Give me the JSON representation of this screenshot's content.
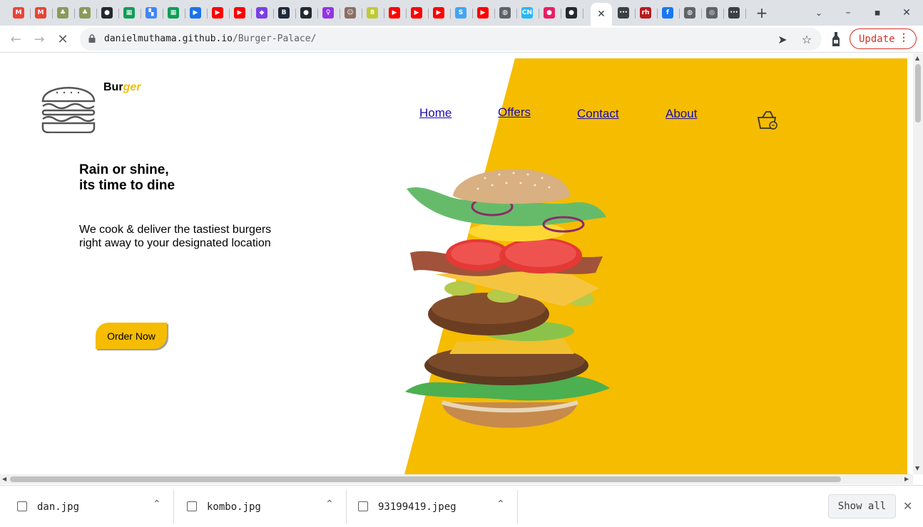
{
  "browser": {
    "tabs": [
      {
        "icon": "gmail-icon",
        "glyph": "M",
        "color": "#ea4335"
      },
      {
        "icon": "gmail-icon",
        "glyph": "M",
        "color": "#ea4335"
      },
      {
        "icon": "tree-icon",
        "glyph": "♣",
        "color": "#8a9a5b"
      },
      {
        "icon": "tree-icon",
        "glyph": "♣",
        "color": "#8a9a5b"
      },
      {
        "icon": "github-icon",
        "glyph": "●",
        "color": "#24292e"
      },
      {
        "icon": "sheets-icon",
        "glyph": "▦",
        "color": "#0f9d58"
      },
      {
        "icon": "colorful-app-icon",
        "glyph": "▚",
        "color": "#4285f4"
      },
      {
        "icon": "sheets-icon",
        "glyph": "▦",
        "color": "#0f9d58"
      },
      {
        "icon": "play-icon",
        "glyph": "▶",
        "color": "#1a73e8"
      },
      {
        "icon": "youtube-icon",
        "glyph": "▶",
        "color": "#ff0000"
      },
      {
        "icon": "youtube-icon",
        "glyph": "▶",
        "color": "#ff0000"
      },
      {
        "icon": "diamond-icon",
        "glyph": "◆",
        "color": "#7b3fe4"
      },
      {
        "icon": "shield-b-icon",
        "glyph": "B",
        "color": "#1e2a3a"
      },
      {
        "icon": "github-icon",
        "glyph": "●",
        "color": "#24292e"
      },
      {
        "icon": "location-pin-icon",
        "glyph": "♀",
        "color": "#9334e6"
      },
      {
        "icon": "person-icon",
        "glyph": "☺",
        "color": "#8d6e63"
      },
      {
        "icon": "badge-8-icon",
        "glyph": "8",
        "color": "#c0ca33"
      },
      {
        "icon": "youtube-icon",
        "glyph": "▶",
        "color": "#ff0000"
      },
      {
        "icon": "youtube-icon",
        "glyph": "▶",
        "color": "#ff0000"
      },
      {
        "icon": "youtube-icon",
        "glyph": "▶",
        "color": "#ff0000"
      },
      {
        "icon": "s-logo-icon",
        "glyph": "S",
        "color": "#42a5f5"
      },
      {
        "icon": "youtube-icon",
        "glyph": "▶",
        "color": "#ff0000"
      },
      {
        "icon": "globe-icon",
        "glyph": "◍",
        "color": "#5f6368"
      },
      {
        "icon": "cn-icon",
        "glyph": "CN",
        "color": "#29b6f6"
      },
      {
        "icon": "red-circle-icon",
        "glyph": "●",
        "color": "#e91e63"
      },
      {
        "icon": "github-icon",
        "glyph": "●",
        "color": "#24292e"
      }
    ],
    "tabs_after_active": [
      {
        "icon": "dots-circle-icon",
        "glyph": "•••",
        "color": "#3c4043"
      },
      {
        "icon": "rh-icon",
        "glyph": "rh",
        "color": "#b71c1c"
      },
      {
        "icon": "facebook-icon",
        "glyph": "f",
        "color": "#1877f2"
      },
      {
        "icon": "globe-icon",
        "glyph": "◍",
        "color": "#5f6368"
      },
      {
        "icon": "chrome-icon",
        "glyph": "◎",
        "color": "#5f6368"
      },
      {
        "icon": "dots-circle-icon",
        "glyph": "•••",
        "color": "#3c4043"
      }
    ],
    "url_host": "danielmuthama.github.io",
    "url_path": "/Burger-Palace/",
    "update_label": "Update"
  },
  "page": {
    "brand_part1": "Bur",
    "brand_part2": "ger",
    "nav": [
      {
        "label": "Home"
      },
      {
        "label": "Offers"
      },
      {
        "label": "Contact"
      },
      {
        "label": "About"
      }
    ],
    "headline_line1": "Rain or shine,",
    "headline_line2": "its time to dine",
    "sub_line1": "We cook & deliver the tastiest burgers",
    "sub_line2": "right away to your designated location",
    "order_label": "Order Now",
    "accent_color": "#f5bc00"
  },
  "downloads": {
    "items": [
      {
        "name": "dan.jpg"
      },
      {
        "name": "kombo.jpg"
      },
      {
        "name": "93199419.jpeg"
      }
    ],
    "show_all_label": "Show all"
  }
}
